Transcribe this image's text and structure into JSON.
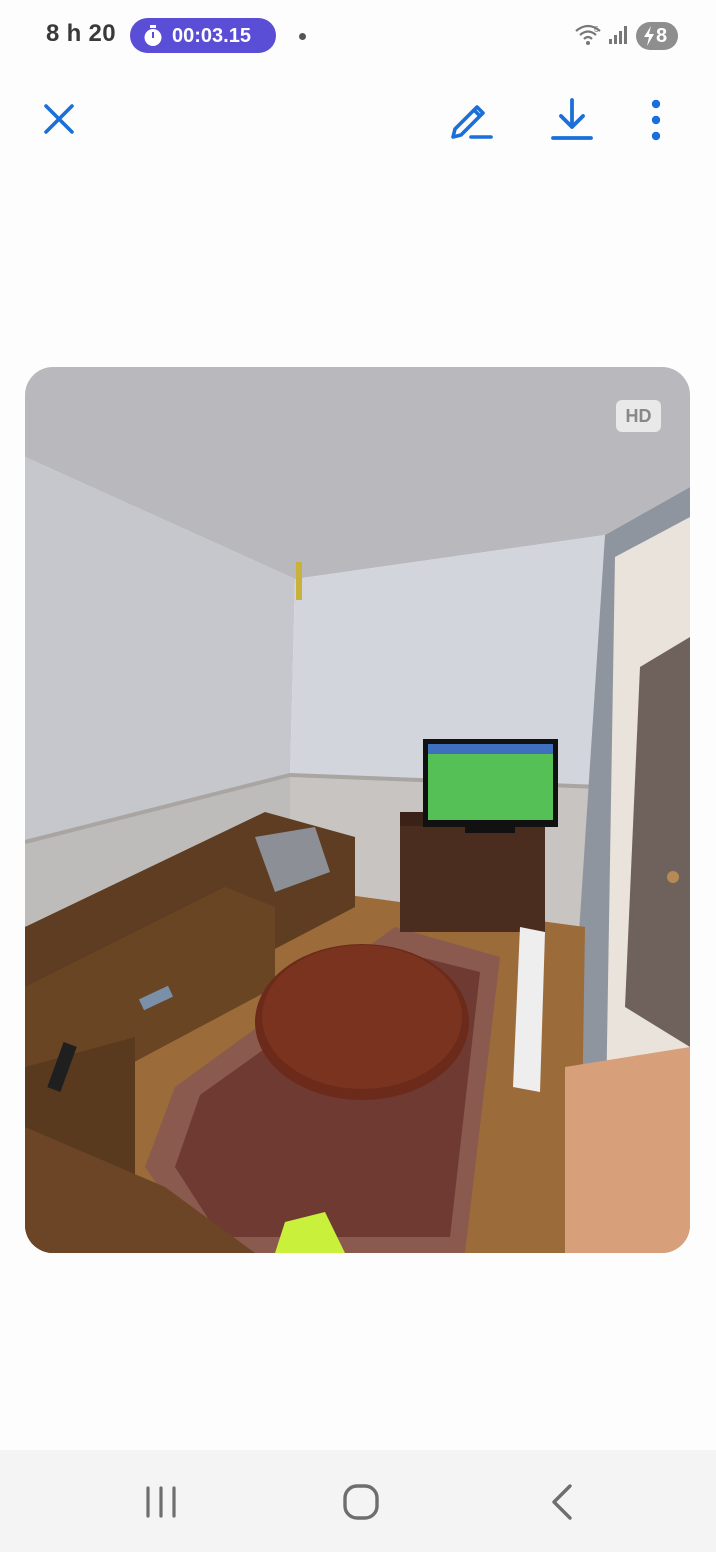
{
  "status_bar": {
    "time": "8 h 20",
    "timer": "00:03.15",
    "battery_level": "8",
    "icons": [
      "stopwatch-icon",
      "notification-dot",
      "wifi-icon",
      "signal-icon",
      "battery-charging-icon"
    ]
  },
  "toolbar": {
    "icons": [
      "close-icon",
      "edit-pen-icon",
      "download-icon",
      "more-vert-icon"
    ],
    "accent_color": "#1a6fd9"
  },
  "viewer": {
    "badge": "HD"
  },
  "nav_bar": {
    "icons": [
      "recents-icon",
      "home-icon",
      "back-icon"
    ]
  },
  "colors": {
    "timer_pill": "#5a4dd6",
    "background": "#fdfdfd",
    "nav_bar": "#f4f4f4"
  }
}
